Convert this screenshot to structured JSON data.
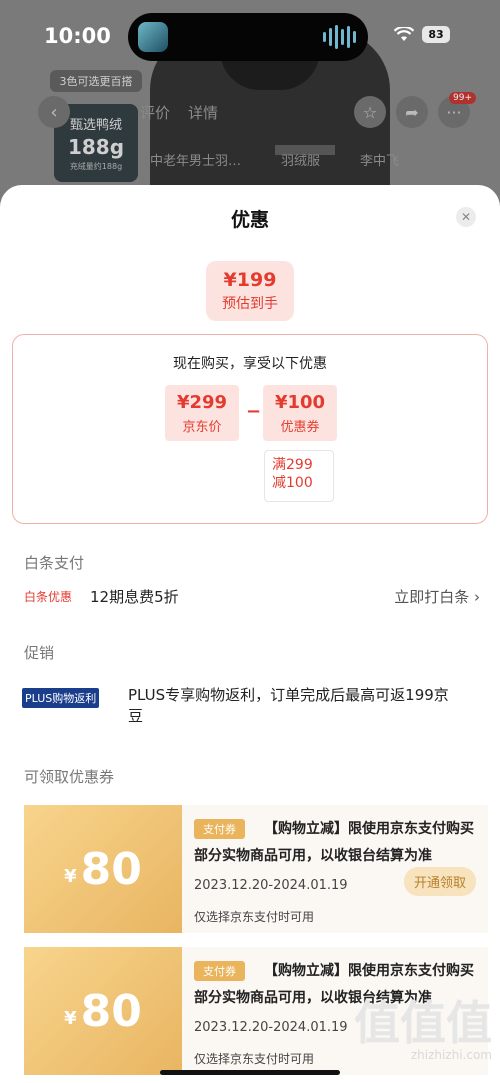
{
  "status_bar": {
    "time": "10:00",
    "battery": "83"
  },
  "background": {
    "color_chip": "3色可选更百搭",
    "down_badge": {
      "line1": "甄选鸭绒",
      "line2": "188g",
      "line3": "充绒量约188g"
    },
    "tabs": [
      "评价",
      "详情"
    ],
    "sub_texts": [
      "中老年男士羽…",
      "羽绒服",
      "李中飞"
    ],
    "cart_count": "99+"
  },
  "sheet": {
    "title": "优惠",
    "estimate": {
      "price": "¥199",
      "label": "预估到手"
    },
    "breakdown": {
      "title": "现在购买，享受以下优惠",
      "jd_price": {
        "price": "¥299",
        "label": "京东价"
      },
      "minus": "−",
      "coupon": {
        "price": "¥100",
        "label": "优惠券"
      },
      "condition": [
        "满299",
        "减100"
      ]
    },
    "baitiao": {
      "section": "白条支付",
      "tag": "白条优惠",
      "text": "12期息费5折",
      "link": "立即打白条 ›"
    },
    "promo": {
      "section": "促销",
      "tag": "PLUS购物返利",
      "text": "PLUS专享购物返利，订单完成后最高可返199京豆"
    },
    "coupons_section": "可领取优惠券",
    "coupons": [
      {
        "currency": "¥",
        "amount": "80",
        "tag": "支付券",
        "desc": "【购物立减】限使用京东支付购买部分实物商品可用，以收银台结算为准",
        "date": "2023.12.20-2024.01.19",
        "note": "仅选择京东支付时可用",
        "button": "开通领取"
      },
      {
        "currency": "¥",
        "amount": "80",
        "tag": "支付券",
        "desc": "【购物立减】限使用京东支付购买部分实物商品可用，以收银台结算为准",
        "date": "2023.12.20-2024.01.19",
        "note": "仅选择京东支付时可用",
        "button": ""
      }
    ]
  },
  "watermark": {
    "big": "值值值",
    "small": "zhizhizhi.com"
  }
}
